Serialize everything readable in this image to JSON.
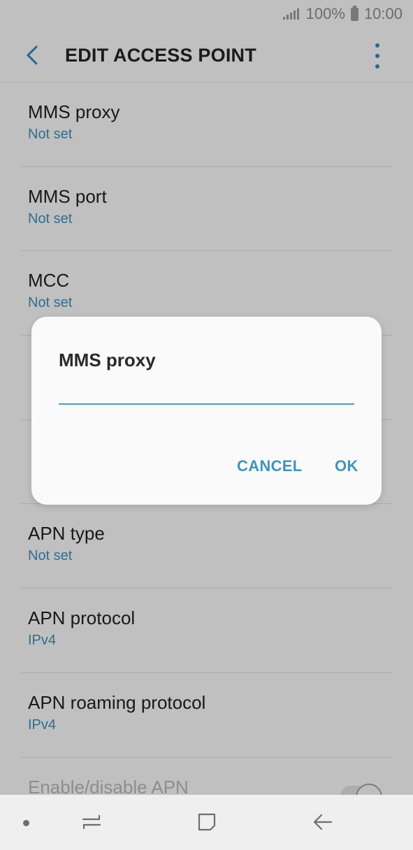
{
  "status_bar": {
    "battery": "100%",
    "time": "10:00"
  },
  "app_bar": {
    "title": "EDIT ACCESS POINT"
  },
  "settings": [
    {
      "label": "MMS proxy",
      "value": "Not set"
    },
    {
      "label": "MMS port",
      "value": "Not set"
    },
    {
      "label": "MCC",
      "value": "Not set"
    },
    {
      "label": "",
      "value": ""
    },
    {
      "label": "",
      "value": ""
    },
    {
      "label": "APN type",
      "value": "Not set"
    },
    {
      "label": "APN protocol",
      "value": "IPv4"
    },
    {
      "label": "APN roaming protocol",
      "value": "IPv4"
    },
    {
      "label": "Enable/disable APN",
      "value": ""
    }
  ],
  "dialog": {
    "title": "MMS proxy",
    "input_value": "",
    "cancel_label": "CANCEL",
    "ok_label": "OK"
  },
  "colors": {
    "accent": "#3a8fbb",
    "background": "#f6f6f6"
  }
}
